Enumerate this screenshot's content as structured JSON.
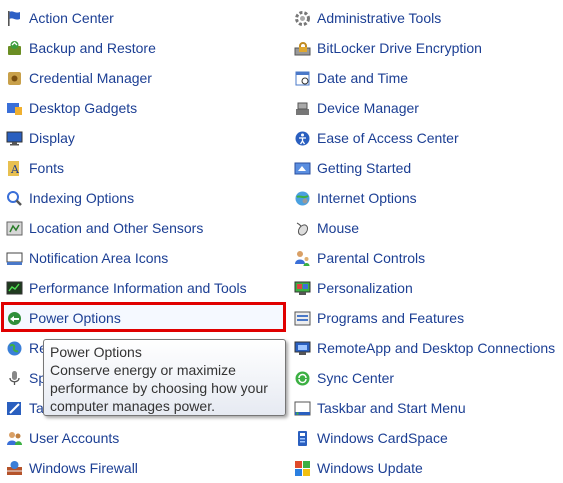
{
  "left_items": [
    {
      "label": "Action Center",
      "icon": "flag-icon"
    },
    {
      "label": "Backup and Restore",
      "icon": "backup-icon"
    },
    {
      "label": "Credential Manager",
      "icon": "credential-icon"
    },
    {
      "label": "Desktop Gadgets",
      "icon": "gadgets-icon"
    },
    {
      "label": "Display",
      "icon": "display-icon"
    },
    {
      "label": "Fonts",
      "icon": "fonts-icon"
    },
    {
      "label": "Indexing Options",
      "icon": "indexing-icon"
    },
    {
      "label": "Location and Other Sensors",
      "icon": "sensors-icon"
    },
    {
      "label": "Notification Area Icons",
      "icon": "notification-icon"
    },
    {
      "label": "Performance Information and Tools",
      "icon": "performance-icon"
    },
    {
      "label": "Power Options",
      "icon": "power-icon"
    },
    {
      "label": "Re",
      "icon": "region-icon"
    },
    {
      "label": "Sp",
      "icon": "speech-icon"
    },
    {
      "label": "Ta",
      "icon": "troubleshoot-icon"
    },
    {
      "label": "User Accounts",
      "icon": "users-icon"
    },
    {
      "label": "Windows Firewall",
      "icon": "firewall-icon"
    }
  ],
  "right_items": [
    {
      "label": "Administrative Tools",
      "icon": "admin-tools-icon"
    },
    {
      "label": "BitLocker Drive Encryption",
      "icon": "bitlocker-icon"
    },
    {
      "label": "Date and Time",
      "icon": "calendar-icon"
    },
    {
      "label": "Device Manager",
      "icon": "device-manager-icon"
    },
    {
      "label": "Ease of Access Center",
      "icon": "ease-of-access-icon"
    },
    {
      "label": "Getting Started",
      "icon": "getting-started-icon"
    },
    {
      "label": "Internet Options",
      "icon": "internet-options-icon"
    },
    {
      "label": "Mouse",
      "icon": "mouse-icon"
    },
    {
      "label": "Parental Controls",
      "icon": "parental-controls-icon"
    },
    {
      "label": "Personalization",
      "icon": "personalization-icon"
    },
    {
      "label": "Programs and Features",
      "icon": "programs-icon"
    },
    {
      "label": "RemoteApp and Desktop Connections",
      "icon": "remoteapp-icon"
    },
    {
      "label": "Sync Center",
      "icon": "sync-icon"
    },
    {
      "label": "Taskbar and Start Menu",
      "icon": "taskbar-icon"
    },
    {
      "label": "Windows CardSpace",
      "icon": "cardspace-icon"
    },
    {
      "label": "Windows Update",
      "icon": "windows-update-icon"
    }
  ],
  "tooltip": {
    "title": "Power Options",
    "body": "Conserve energy or maximize performance by choosing how your computer manages power."
  },
  "colors": {
    "link": "#1c3f94",
    "highlight_border": "#e00000"
  }
}
